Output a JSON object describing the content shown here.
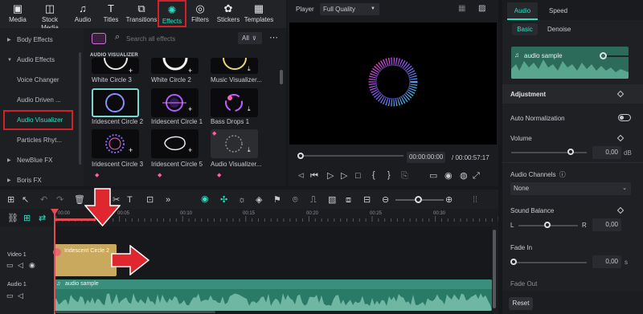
{
  "toolbar": {
    "items": [
      {
        "label": "Media",
        "icon": "media-icon"
      },
      {
        "label": "Stock Media",
        "icon": "stock-media-icon"
      },
      {
        "label": "Audio",
        "icon": "audio-icon"
      },
      {
        "label": "Titles",
        "icon": "titles-icon"
      },
      {
        "label": "Transitions",
        "icon": "transitions-icon"
      },
      {
        "label": "Effects",
        "icon": "effects-icon"
      },
      {
        "label": "Filters",
        "icon": "filters-icon"
      },
      {
        "label": "Stickers",
        "icon": "stickers-icon"
      },
      {
        "label": "Templates",
        "icon": "templates-icon"
      }
    ]
  },
  "sidebar": {
    "items": [
      {
        "label": "Body Effects"
      },
      {
        "label": "Audio Effects"
      },
      {
        "label": "Voice Changer"
      },
      {
        "label": "Audio Driven ..."
      },
      {
        "label": "Audio Visualizer"
      },
      {
        "label": "Particles Rhyt..."
      },
      {
        "label": "NewBlue FX"
      },
      {
        "label": "Boris FX"
      }
    ]
  },
  "effects": {
    "search_placeholder": "Search all effects",
    "filter_label": "All",
    "section_title": "AUDIO VISUALIZER",
    "cards": [
      {
        "name": "White Circle 3"
      },
      {
        "name": "White Circle 2"
      },
      {
        "name": "Music Visualizer..."
      },
      {
        "name": "Iridescent Circle 2"
      },
      {
        "name": "Iridescent Circle 1"
      },
      {
        "name": "Bass Drops 1"
      },
      {
        "name": "Iridescent Circle 3"
      },
      {
        "name": "Iridescent Circle 5"
      },
      {
        "name": "Audio Visualizer..."
      }
    ]
  },
  "player": {
    "label": "Player",
    "quality": "Full Quality",
    "current_time": "00:00:00:00",
    "total_time": "/ 00:00:57:17"
  },
  "properties": {
    "tabs": [
      "Audio",
      "Speed"
    ],
    "subtabs": [
      "Basic",
      "Denoise"
    ],
    "audio_sample": "audio sample",
    "adjustment": "Adjustment",
    "auto_normalization": "Auto Normalization",
    "volume_label": "Volume",
    "volume_value": "0,00",
    "volume_unit": "dB",
    "channels_label": "Audio Channels",
    "channels_value": "None",
    "balance_label": "Sound Balance",
    "balance_l": "L",
    "balance_r": "R",
    "balance_value": "0,00",
    "fadein_label": "Fade In",
    "fadein_value": "0,00",
    "fadein_unit": "s",
    "fadeout_label": "Fade Out",
    "reset_label": "Reset"
  },
  "timeline": {
    "ruler": [
      "00:00",
      "00:05",
      "00:10",
      "00:15",
      "00:20",
      "00:25",
      "00:30"
    ],
    "video_track_label": "Video 1",
    "audio_track_label": "Audio 1",
    "effect_clip": "Iridescent Circle 2",
    "audio_clip": "audio sample"
  },
  "colors": {
    "accent": "#2ce0c2",
    "highlight": "#d0222b",
    "clip_effect": "#c9a95e",
    "clip_audio": "#2a7a68"
  }
}
